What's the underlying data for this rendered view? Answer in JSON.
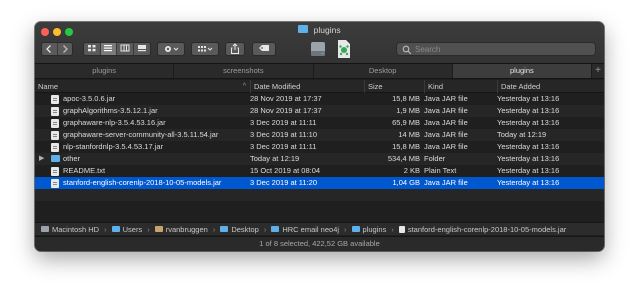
{
  "window": {
    "title": "plugins"
  },
  "toolbar": {
    "back_icon": "chevron-left-icon",
    "forward_icon": "chevron-right-icon",
    "view_modes": [
      "icon-view-icon",
      "list-view-icon",
      "column-view-icon",
      "gallery-view-icon"
    ],
    "action_icon": "gear-icon",
    "group_icon": "group-grid-icon",
    "share_icon": "share-icon",
    "tag_icon": "tag-icon",
    "search_placeholder": "Search"
  },
  "tabs": [
    {
      "label": "plugins",
      "active": false
    },
    {
      "label": "screenshots",
      "active": false
    },
    {
      "label": "Desktop",
      "active": false
    },
    {
      "label": "plugins",
      "active": true
    }
  ],
  "columns": {
    "name": "Name",
    "date": "Date Modified",
    "size": "Size",
    "kind": "Kind",
    "added": "Date Added"
  },
  "files": [
    {
      "name": "apoc-3.5.0.6.jar",
      "date": "28 Nov 2019 at 17:37",
      "size": "15,8 MB",
      "kind": "Java JAR file",
      "added": "Yesterday at 13:16",
      "type": "file"
    },
    {
      "name": "graphAlgorithms-3.5.12.1.jar",
      "date": "28 Nov 2019 at 17:37",
      "size": "1,9 MB",
      "kind": "Java JAR file",
      "added": "Yesterday at 13:16",
      "type": "file"
    },
    {
      "name": "graphaware-nlp-3.5.4.53.16.jar",
      "date": "3 Dec 2019 at 11:11",
      "size": "65,9 MB",
      "kind": "Java JAR file",
      "added": "Yesterday at 13:16",
      "type": "file"
    },
    {
      "name": "graphaware-server-community-all-3.5.11.54.jar",
      "date": "3 Dec 2019 at 11:10",
      "size": "14 MB",
      "kind": "Java JAR file",
      "added": "Today at 12:19",
      "type": "file"
    },
    {
      "name": "nlp-stanfordnlp-3.5.4.53.17.jar",
      "date": "3 Dec 2019 at 11:11",
      "size": "15,8 MB",
      "kind": "Java JAR file",
      "added": "Yesterday at 13:16",
      "type": "file"
    },
    {
      "name": "other",
      "date": "Today at 12:19",
      "size": "534,4 MB",
      "kind": "Folder",
      "added": "Yesterday at 13:16",
      "type": "folder"
    },
    {
      "name": "README.txt",
      "date": "15 Oct 2019 at 08:04",
      "size": "2 KB",
      "kind": "Plain Text",
      "added": "Yesterday at 13:16",
      "type": "file"
    },
    {
      "name": "stanford-english-corenlp-2018-10-05-models.jar",
      "date": "3 Dec 2019 at 11:20",
      "size": "1,04 GB",
      "kind": "Java JAR file",
      "added": "Yesterday at 13:16",
      "type": "file",
      "selected": true
    }
  ],
  "path": [
    "Macintosh HD",
    "Users",
    "rvanbruggen",
    "Desktop",
    "HRC email neo4j",
    "plugins",
    "stanford-english-corenlp-2018-10-05-models.jar"
  ],
  "status": "1 of 8 selected, 422,52 GB available",
  "colors": {
    "selection": "#0058d0",
    "folder": "#5db0e8",
    "close": "#fe5f57",
    "minimize": "#febc2e",
    "maximize": "#28c840"
  }
}
